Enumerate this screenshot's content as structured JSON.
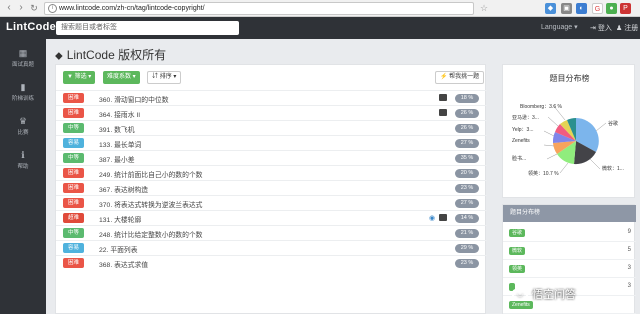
{
  "browser": {
    "url": "www.lintcode.com/zh-cn/tag/lintcode-copyright/"
  },
  "topbar": {
    "logo": "LintCode",
    "search_placeholder": "搜索题目或者标签",
    "language": "Language ▾",
    "login": "登入",
    "register": "注册"
  },
  "sidebar": {
    "items": [
      {
        "label": "面试真题",
        "icon": "cube-icon"
      },
      {
        "label": "阶梯训练",
        "icon": "bar-chart-icon"
      },
      {
        "label": "比赛",
        "icon": "trophy-icon"
      },
      {
        "label": "帮助",
        "icon": "info-icon"
      }
    ]
  },
  "page": {
    "title": "LintCode 版权所有"
  },
  "toolbar": {
    "filter": "▼ 筛选 ▾",
    "difficulty": "难度系数 ▾",
    "sort": "排序 ▾",
    "random": "帮我挑一题"
  },
  "problems": [
    {
      "difficulty": "困难",
      "title": "360. 滑动窗口的中位数",
      "rate": "18 %",
      "lock": true
    },
    {
      "difficulty": "困难",
      "title": "364. 接雨水 II",
      "rate": "26 %",
      "lock": true
    },
    {
      "difficulty": "中等",
      "title": "391. 数飞机",
      "rate": "26 %",
      "lock": false
    },
    {
      "difficulty": "容易",
      "title": "133. 最长单词",
      "rate": "27 %",
      "lock": false
    },
    {
      "difficulty": "中等",
      "title": "387. 最小差",
      "rate": "35 %",
      "lock": false
    },
    {
      "difficulty": "困难",
      "title": "249. 统计前面比自己小的数的个数",
      "rate": "20 %",
      "lock": false
    },
    {
      "difficulty": "困难",
      "title": "367. 表达树构造",
      "rate": "23 %",
      "lock": false
    },
    {
      "difficulty": "困难",
      "title": "370. 将表达式转换为逆波兰表达式",
      "rate": "27 %",
      "lock": false
    },
    {
      "difficulty": "超难",
      "title": "131. 大楼轮廓",
      "rate": "14 %",
      "lock": true,
      "eye": true
    },
    {
      "difficulty": "中等",
      "title": "248. 统计比给定整数小的数的个数",
      "rate": "21 %",
      "lock": false
    },
    {
      "difficulty": "容易",
      "title": "22. 平面列表",
      "rate": "29 %",
      "lock": false
    },
    {
      "difficulty": "困难",
      "title": "368. 表达式求值",
      "rate": "23 %",
      "lock": false
    }
  ],
  "chart": {
    "title": "题目分布榜",
    "labels": [
      {
        "text": "Bloomberg：3.6 %"
      },
      {
        "text": "亚马逊：3..."
      },
      {
        "text": "Yelp：3..."
      },
      {
        "text": "Zenefits"
      },
      {
        "text": "脸书..."
      },
      {
        "text": "谷歌"
      },
      {
        "text": "微软：1..."
      },
      {
        "text": "领英：10.7 %"
      }
    ]
  },
  "company_list": {
    "header": "题目分布榜",
    "items": [
      {
        "name": "谷歌",
        "count": "9"
      },
      {
        "name": "微软",
        "count": "5"
      },
      {
        "name": "领英",
        "count": "3"
      },
      {
        "name": "",
        "count": "3"
      },
      {
        "name": "Zenefits",
        "count": ""
      }
    ]
  },
  "watermark": {
    "text": "悟空问答"
  }
}
